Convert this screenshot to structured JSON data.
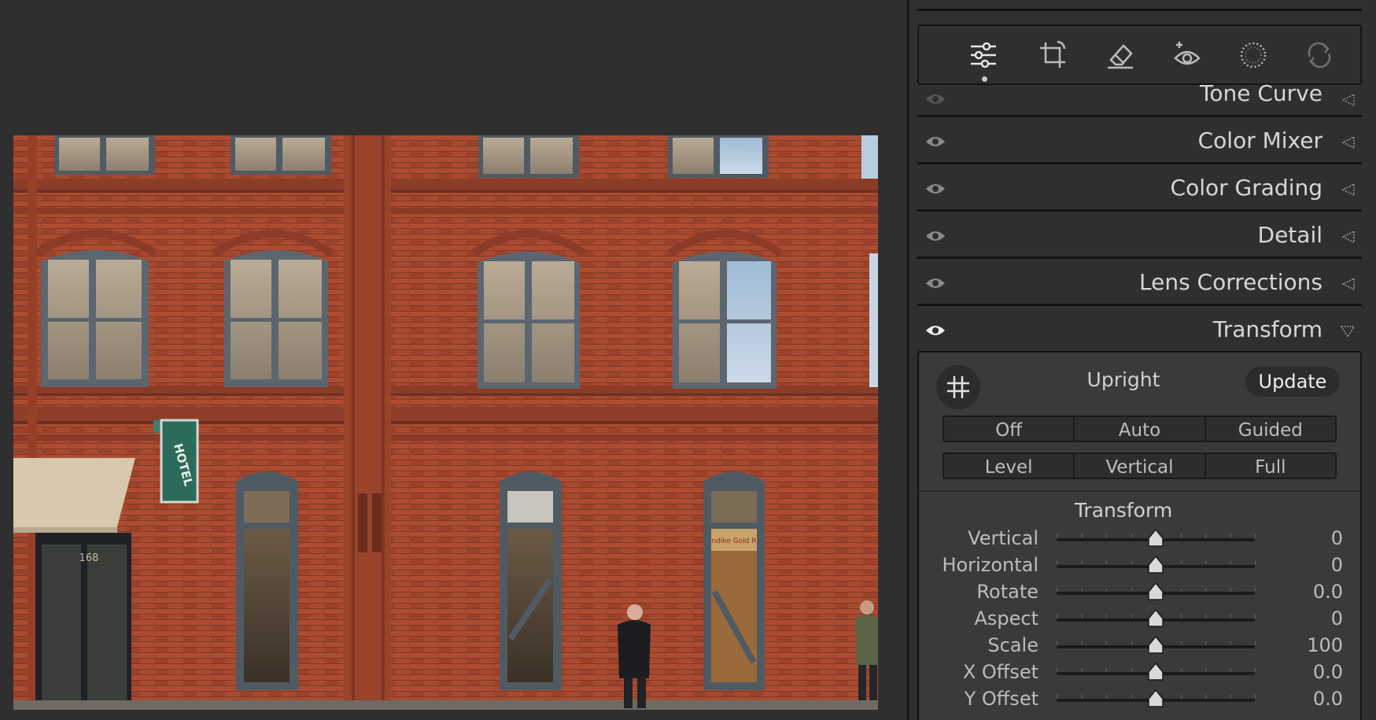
{
  "toolstrip": {
    "tools": [
      {
        "name": "edit-sliders",
        "active": true
      },
      {
        "name": "crop"
      },
      {
        "name": "heal-eraser"
      },
      {
        "name": "red-eye"
      },
      {
        "name": "masking"
      },
      {
        "name": "presets-remix"
      }
    ]
  },
  "sections": [
    {
      "title": "Tone Curve"
    },
    {
      "title": "Color Mixer"
    },
    {
      "title": "Color Grading"
    },
    {
      "title": "Detail"
    },
    {
      "title": "Lens Corrections"
    },
    {
      "title": "Transform",
      "expanded": true
    }
  ],
  "transform": {
    "upright_label": "Upright",
    "update_label": "Update",
    "upright_modes_row1": [
      "Off",
      "Auto",
      "Guided"
    ],
    "upright_modes_row2": [
      "Level",
      "Vertical",
      "Full"
    ],
    "heading": "Transform",
    "sliders": [
      {
        "label": "Vertical",
        "value": "0",
        "position": 0.5
      },
      {
        "label": "Horizontal",
        "value": "0",
        "position": 0.5
      },
      {
        "label": "Rotate",
        "value": "0.0",
        "position": 0.5
      },
      {
        "label": "Aspect",
        "value": "0",
        "position": 0.5
      },
      {
        "label": "Scale",
        "value": "100",
        "position": 0.5
      },
      {
        "label": "X Offset",
        "value": "0.0",
        "position": 0.5
      },
      {
        "label": "Y Offset",
        "value": "0.0",
        "position": 0.5
      }
    ]
  },
  "photo": {
    "door_number": "168",
    "sign_text": "HOTEL",
    "window_sign_text": "ndike Gold R"
  }
}
